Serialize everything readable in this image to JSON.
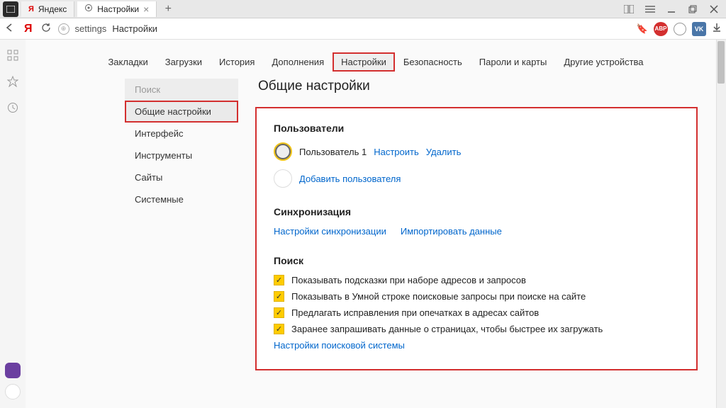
{
  "titlebar": {
    "tab1": {
      "label": "Яндекс"
    },
    "tab2": {
      "label": "Настройки"
    }
  },
  "addrbar": {
    "y": "Я",
    "url_left": "settings",
    "url_right": "Настройки"
  },
  "topnav": {
    "bookmarks": "Закладки",
    "downloads": "Загрузки",
    "history": "История",
    "addons": "Дополнения",
    "settings": "Настройки",
    "security": "Безопасность",
    "passwords": "Пароли и карты",
    "devices": "Другие устройства"
  },
  "sidebar": {
    "search": "Поиск",
    "general": "Общие настройки",
    "interface": "Интерфейс",
    "tools": "Инструменты",
    "sites": "Сайты",
    "system": "Системные"
  },
  "panel": {
    "title": "Общие настройки",
    "users": {
      "heading": "Пользователи",
      "user1": "Пользователь 1",
      "configure": "Настроить",
      "delete": "Удалить",
      "add": "Добавить пользователя"
    },
    "sync": {
      "heading": "Синхронизация",
      "settings": "Настройки синхронизации",
      "import": "Импортировать данные"
    },
    "search": {
      "heading": "Поиск",
      "opt1": "Показывать подсказки при наборе адресов и запросов",
      "opt2": "Показывать в Умной строке поисковые запросы при поиске на сайте",
      "opt3": "Предлагать исправления при опечатках в адресах сайтов",
      "opt4": "Заранее запрашивать данные о страницах, чтобы быстрее их загружать",
      "engine": "Настройки поисковой системы"
    }
  }
}
